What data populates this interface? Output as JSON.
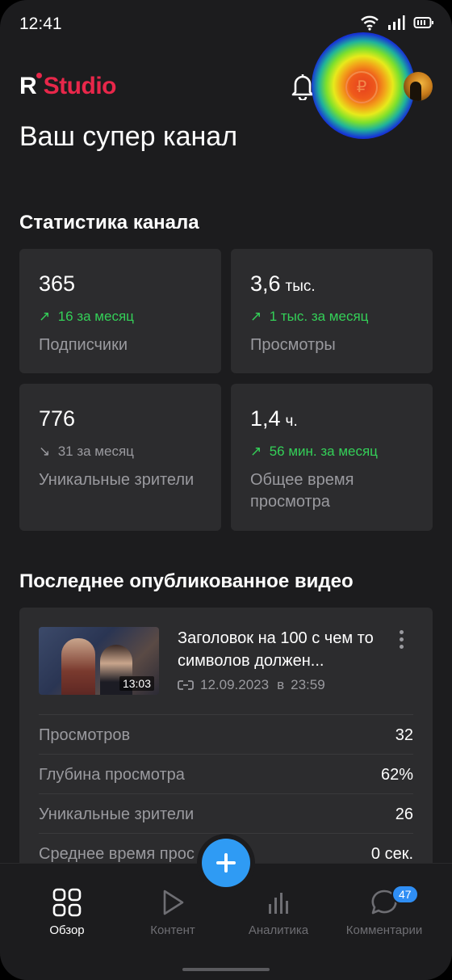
{
  "status_bar": {
    "time": "12:41"
  },
  "header": {
    "logo_r": "R",
    "logo_studio": "Studio",
    "channel_title": "Ваш супер канал",
    "coin_symbol": "₽"
  },
  "stats": {
    "title": "Статистика канала",
    "cards": [
      {
        "value": "365",
        "unit": "",
        "delta": "16 за месяц",
        "trend": "up",
        "label": "Подписчики"
      },
      {
        "value": "3,6",
        "unit": "тыс.",
        "delta": "1 тыс. за месяц",
        "trend": "up",
        "label": "Просмотры"
      },
      {
        "value": "776",
        "unit": "",
        "delta": "31 за месяц",
        "trend": "down",
        "label": "Уникальные зрители"
      },
      {
        "value": "1,4",
        "unit": "ч.",
        "delta": "56 мин. за месяц",
        "trend": "up",
        "label": "Общее время просмотра"
      }
    ]
  },
  "latest_video": {
    "title": "Последнее опубликованное видео",
    "video_title": "Заголовок на 100 с чем то символов должен...",
    "duration": "13:03",
    "date": "12.09.2023",
    "time_prefix": "в",
    "time": "23:59",
    "rows": [
      {
        "label": "Просмотров",
        "value": "32"
      },
      {
        "label": "Глубина просмотра",
        "value": "62%"
      },
      {
        "label": "Уникальные зрители",
        "value": "26"
      },
      {
        "label": "Среднее время прос",
        "value": "0 сек."
      }
    ]
  },
  "nav": {
    "items": [
      {
        "label": "Обзор",
        "icon": "grid-icon",
        "active": true
      },
      {
        "label": "Контент",
        "icon": "play-icon",
        "active": false
      },
      {
        "label": "Аналитика",
        "icon": "bar-chart-icon",
        "active": false
      },
      {
        "label": "Комментарии",
        "icon": "comment-icon",
        "active": false,
        "badge": "47"
      }
    ]
  },
  "colors": {
    "accent_red": "#e8274a",
    "up_green": "#34d058",
    "fab_blue": "#2f9bf4",
    "card_bg": "#2c2c2e",
    "bg": "#1c1c1e"
  }
}
